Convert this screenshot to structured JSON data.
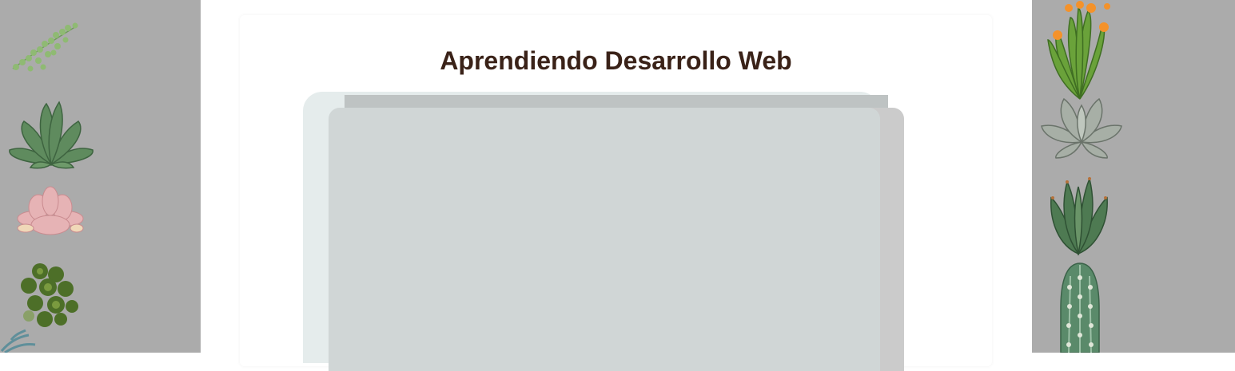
{
  "page": {
    "title": "Aprendiendo Desarrollo Web"
  },
  "decor": {
    "left_plants": [
      "string-of-pearls-icon",
      "green-echeveria-icon",
      "pink-succulent-icon",
      "leafy-sedum-icon",
      "blue-leaf-icon"
    ],
    "right_plants": [
      "flowering-cactus-icon",
      "grey-rosette-icon",
      "aloe-icon",
      "columnar-cactus-icon"
    ]
  },
  "colors": {
    "side_panel": "#ababab",
    "title_text": "#3a2218",
    "placeholder_back": "#e5ecec",
    "placeholder_front": "#d0d6d6"
  }
}
